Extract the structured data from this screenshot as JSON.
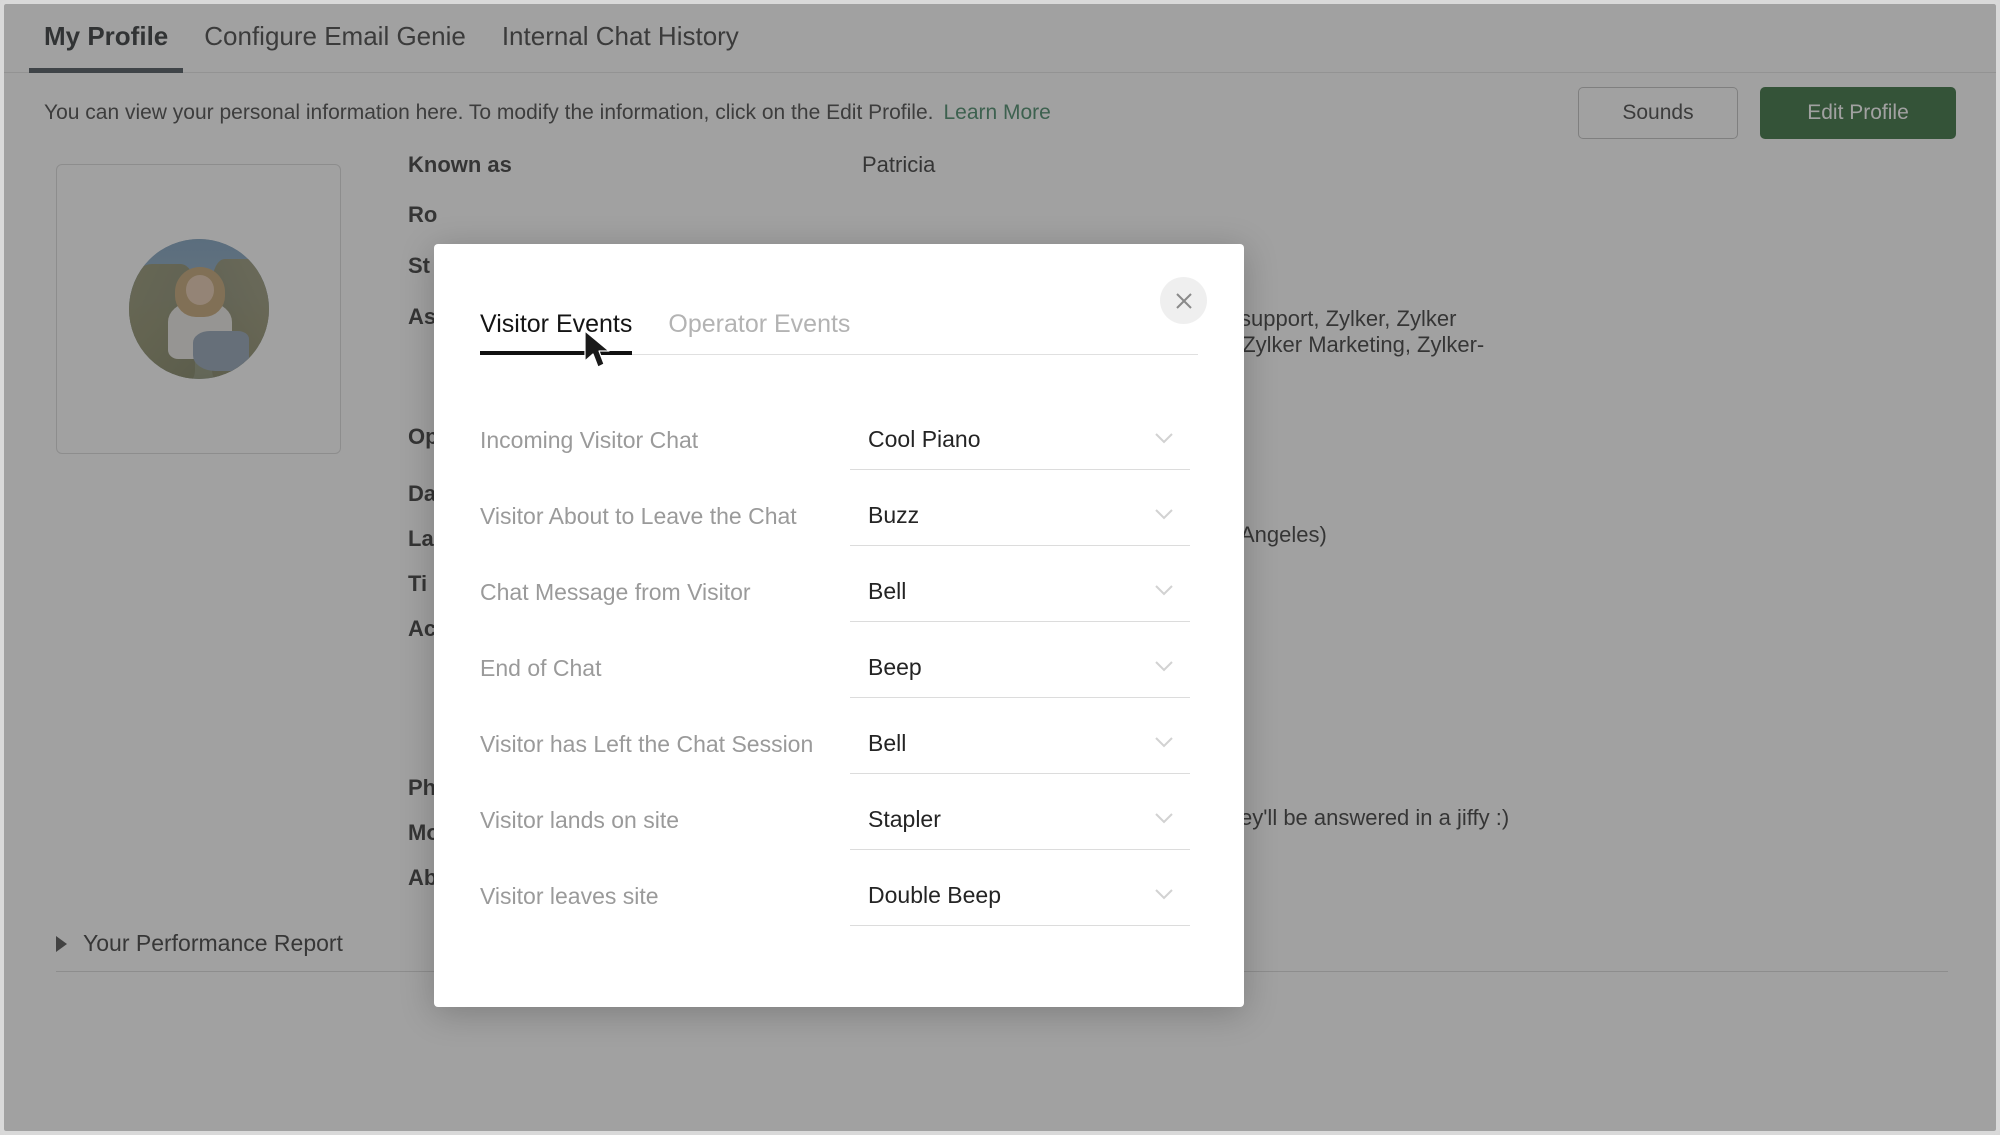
{
  "page": {
    "tabs": [
      {
        "label": "My Profile",
        "active": true
      },
      {
        "label": "Configure Email Genie",
        "active": false
      },
      {
        "label": "Internal Chat History",
        "active": false
      }
    ],
    "infobar": {
      "text": "You can view your personal information here. To modify the information, click on the Edit Profile.",
      "learn_more": "Learn More",
      "sounds_button": "Sounds",
      "edit_profile_button": "Edit Profile"
    },
    "fields_left": [
      {
        "label": "Known as",
        "value": "Patricia"
      },
      {
        "label": "Ro",
        "value": ""
      },
      {
        "label": "St",
        "value": ""
      },
      {
        "label": "As",
        "value": ""
      },
      {
        "label": "Op",
        "value": ""
      },
      {
        "label": "Da",
        "value": ""
      },
      {
        "label": "La",
        "value": ""
      },
      {
        "label": "Ti",
        "value": ""
      },
      {
        "label": "Ac",
        "value": ""
      },
      {
        "label": "Ph",
        "value": ""
      },
      {
        "label": "Mo",
        "value": ""
      },
      {
        "label": "Ab",
        "value": ""
      }
    ],
    "fields_right": [
      "support, Zylker, Zylker",
      ", Zylker Marketing, Zylker-",
      "Angeles)",
      "ey'll be answered in a jiffy :)"
    ],
    "performance_report": "Your Performance Report"
  },
  "modal": {
    "tabs": [
      {
        "label": "Visitor Events",
        "active": true
      },
      {
        "label": "Operator Events",
        "active": false
      }
    ],
    "close_label": "Close",
    "rows": [
      {
        "label": "Incoming Visitor Chat",
        "value": "Cool Piano"
      },
      {
        "label": "Visitor About to Leave the Chat",
        "value": "Buzz"
      },
      {
        "label": "Chat Message from Visitor",
        "value": "Bell"
      },
      {
        "label": "End of Chat",
        "value": "Beep"
      },
      {
        "label": "Visitor has Left the Chat Session",
        "value": "Bell"
      },
      {
        "label": "Visitor lands on site",
        "value": "Stapler"
      },
      {
        "label": "Visitor leaves site",
        "value": "Double Beep"
      }
    ]
  },
  "colors": {
    "primary_green": "#1d5c25",
    "link_green": "#2f7a55",
    "active_tab_underline": "#343d46",
    "modal_tab_underline": "#111111"
  }
}
